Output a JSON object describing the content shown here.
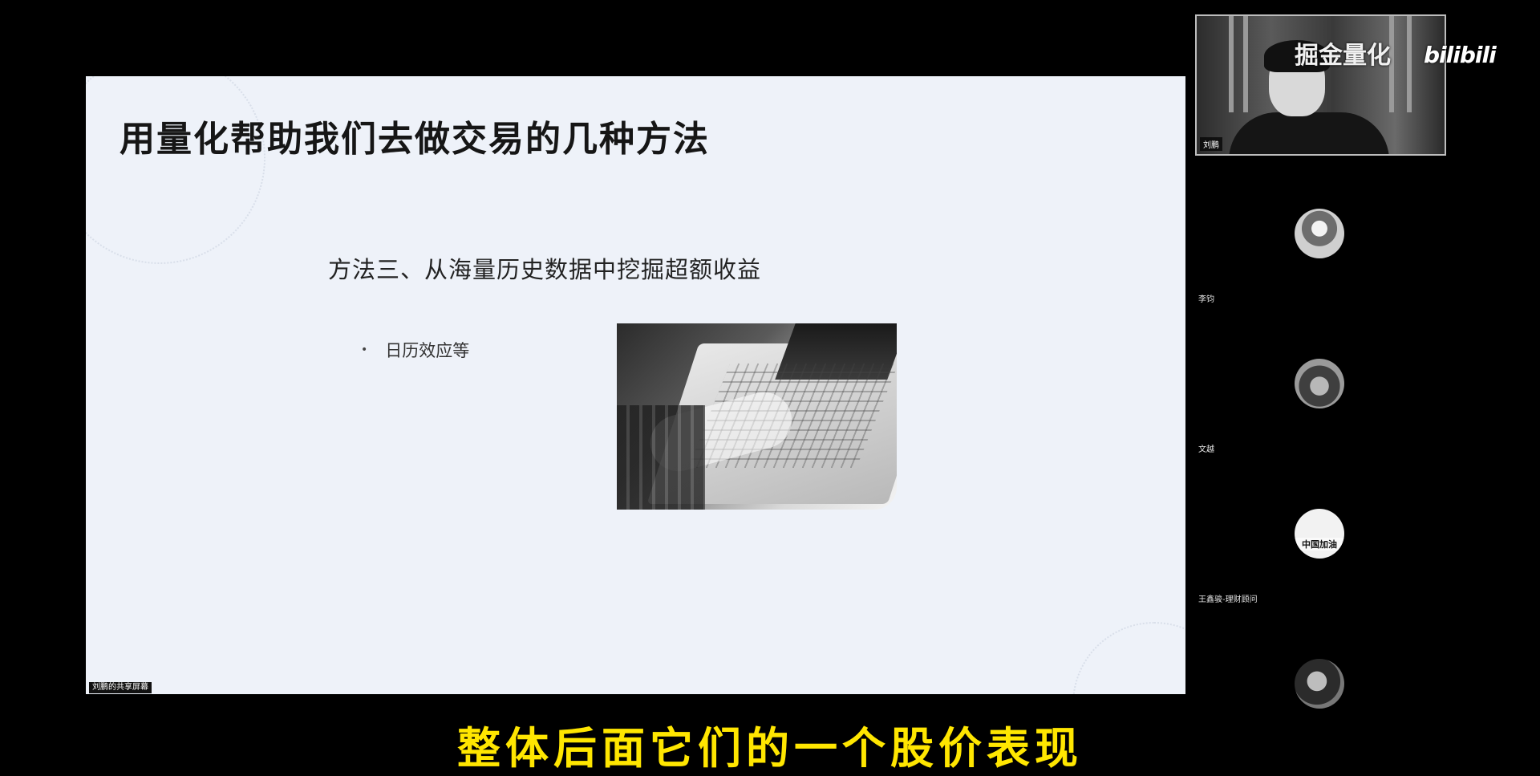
{
  "slide": {
    "title": "用量化帮助我们去做交易的几种方法",
    "method_heading": "方法三、从海量历史数据中挖掘超额收益",
    "bullets": [
      {
        "marker": "•",
        "text": "日历效应等"
      }
    ],
    "share_label": "刘鹏的共享屏幕"
  },
  "speaker": {
    "name": "刘鹏",
    "watermark": "掘金量化",
    "logo_text": "bilibili"
  },
  "participants": [
    {
      "name": "李钧",
      "avatar_icon": "avatar-icon"
    },
    {
      "name": "文越",
      "avatar_icon": "avatar-icon"
    },
    {
      "name": "王鑫骏-理财顾问",
      "avatar_icon": "avatar-icon",
      "avatar_text": "中国加油"
    },
    {
      "name": "",
      "avatar_icon": "avatar-icon"
    }
  ],
  "subtitle": "整体后面它们的一个股价表现"
}
